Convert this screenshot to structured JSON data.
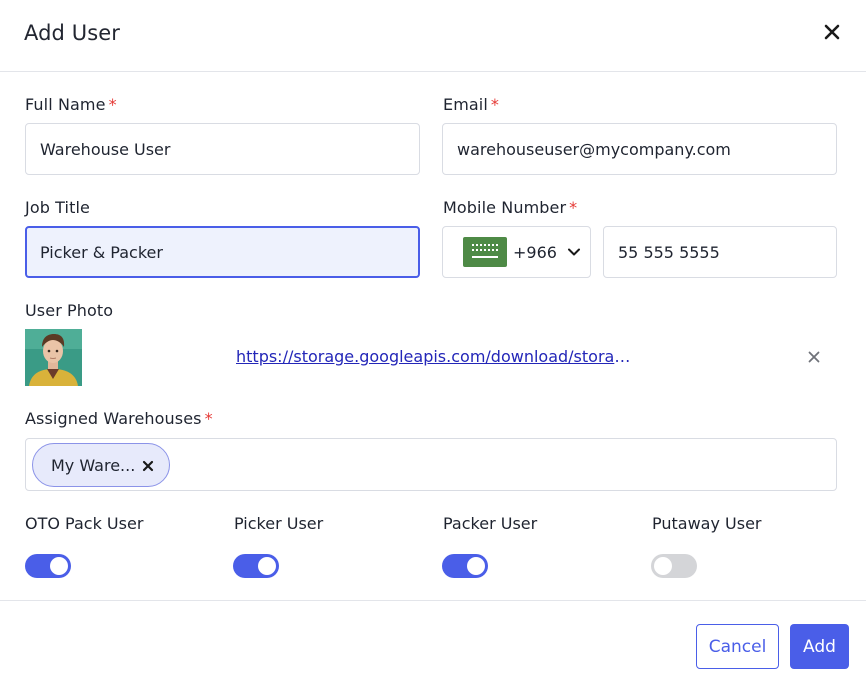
{
  "dialog": {
    "title": "Add User",
    "close_icon": "close-icon"
  },
  "form": {
    "full_name": {
      "label": "Full Name",
      "required_mark": "*",
      "value": "Warehouse User"
    },
    "email": {
      "label": "Email",
      "required_mark": "*",
      "value": "warehouseuser@mycompany.com"
    },
    "job_title": {
      "label": "Job Title",
      "value": "Picker & Packer"
    },
    "mobile": {
      "label": "Mobile Number",
      "required_mark": "*",
      "country_flag_icon": "saudi-arabia-flag-icon",
      "country_code": "+966",
      "number": "55 555 5555"
    },
    "user_photo": {
      "label": "User Photo",
      "link": "https://storage.googleapis.com/download/storage/v1/b/user-photos/o/avatar.png",
      "remove_icon": "close-icon"
    },
    "warehouses": {
      "label": "Assigned Warehouses",
      "required_mark": "*",
      "chips": [
        {
          "label": "My Ware..."
        }
      ]
    },
    "roles": [
      {
        "label": "OTO Pack User",
        "enabled": true
      },
      {
        "label": "Picker User",
        "enabled": true
      },
      {
        "label": "Packer User",
        "enabled": true
      },
      {
        "label": "Putaway User",
        "enabled": false
      }
    ]
  },
  "footer": {
    "cancel_label": "Cancel",
    "add_label": "Add"
  },
  "colors": {
    "accent": "#4a5ee8",
    "required": "#e53935",
    "focused_bg": "#eef2fd",
    "link": "#2326b8",
    "toggle_off": "#d4d5d8"
  }
}
